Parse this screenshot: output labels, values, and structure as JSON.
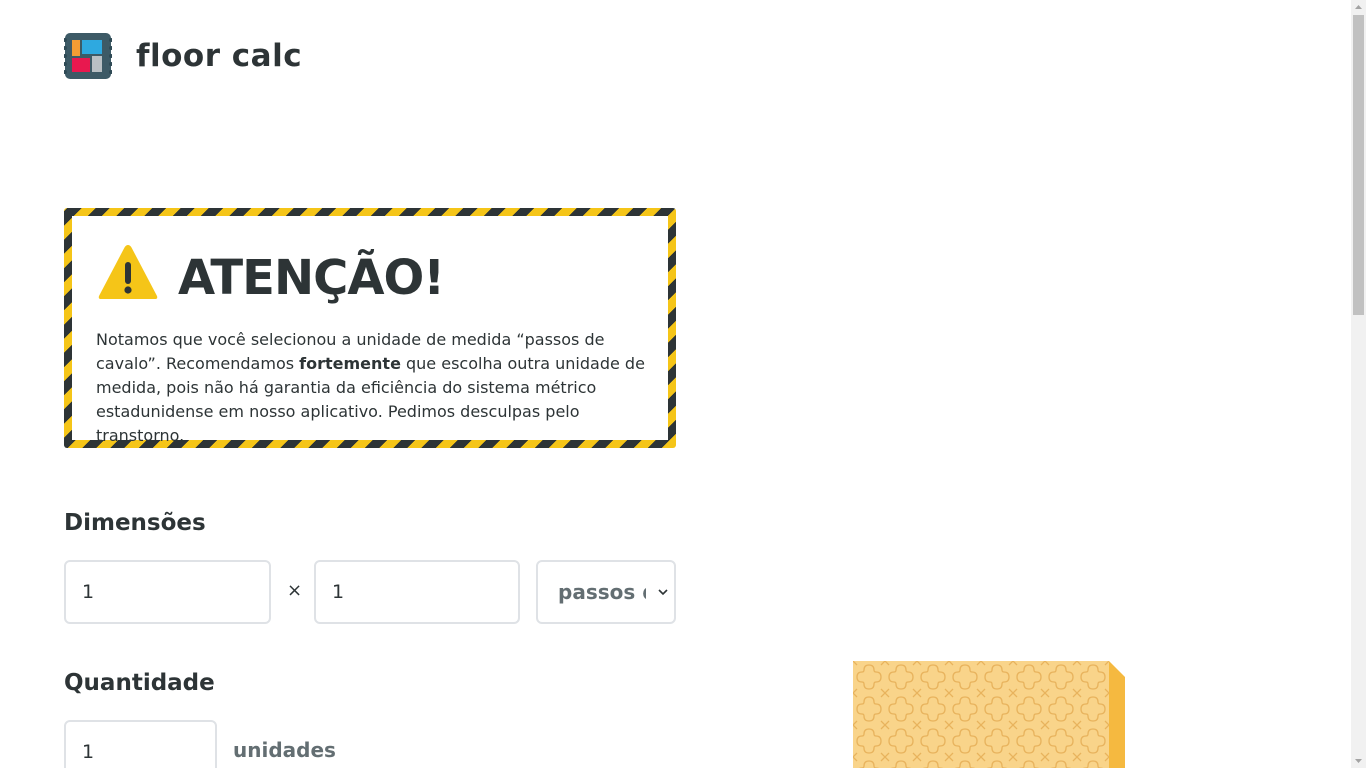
{
  "header": {
    "brand": "floor calc",
    "logo_icon": "tile-logo-icon"
  },
  "warning": {
    "icon": "warning-triangle-icon",
    "title": "ATENÇÃO!",
    "text_part1": "Notamos que você selecionou a unidade de medida “passos de cavalo”. Recomendamos ",
    "text_bold": "fortemente",
    "text_part2": " que escolha outra unidade de medida, pois não há garantia da eficiência do sistema métrico estadunidense em nosso aplicativo. Pedimos desculpas pelo transtorno."
  },
  "dimensions": {
    "title": "Dimensões",
    "width_value": "1",
    "height_value": "1",
    "separator": "×",
    "unit_selected": "passos de cavalo"
  },
  "quantity": {
    "title": "Quantidade",
    "value": "1",
    "unit_label": "unidades"
  },
  "preview": {
    "icon": "tile-preview-icon"
  },
  "colors": {
    "accent_yellow": "#f5c518",
    "dark": "#2d3436",
    "muted": "#636e72",
    "tile_fill": "#f9d48a",
    "tile_edge": "#f5b940"
  }
}
